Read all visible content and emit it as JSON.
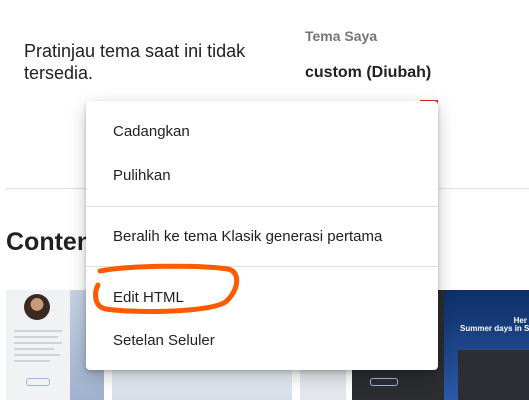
{
  "preview": {
    "message": "Pratinjau tema saat ini tidak tersedia."
  },
  "theme": {
    "label": "Tema Saya",
    "name": "custom (Diubah)"
  },
  "section": {
    "title": "Conten"
  },
  "thumbnails": {
    "blog_title": "Summer days in Santorini",
    "hero_text": "Her"
  },
  "menu": {
    "items": [
      {
        "label": "Cadangkan"
      },
      {
        "label": "Pulihkan"
      },
      {
        "label": "Beralih ke tema Klasik generasi pertama"
      },
      {
        "label": "Edit HTML"
      },
      {
        "label": "Setelan Seluler"
      }
    ]
  },
  "colors": {
    "annotation": "#ff5a00",
    "action_button": "#c5391f"
  }
}
